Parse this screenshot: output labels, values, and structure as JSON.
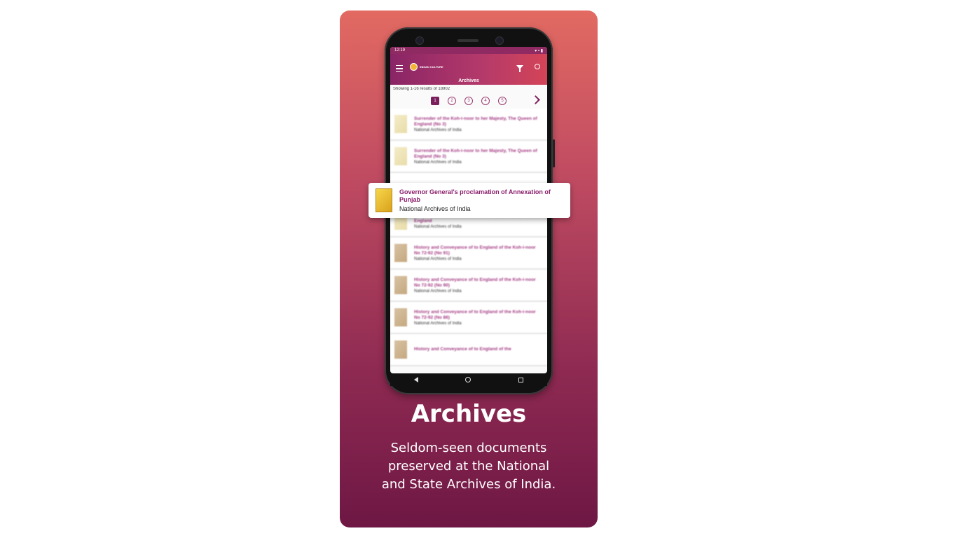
{
  "card": {
    "title": "Archives",
    "description": "Seldom-seen documents preserved at the National and State Archives of India."
  },
  "phone": {
    "status": {
      "time": "12:19",
      "icons": "▾ ▪ ▮"
    },
    "appbar": {
      "logo_text": "INDIAN CULTURE",
      "title": "Archives"
    },
    "results_text": "Showing 1-16 results of 18902",
    "pages": [
      "1",
      "2",
      "3",
      "4",
      "5"
    ],
    "list": [
      {
        "title": "Surrender of the Koh-i-noor to her Majesty, The Queen of England (No 3)",
        "source": "National Archives of India",
        "thumb": "light"
      },
      {
        "title": "Surrender of the Koh-i-noor to her Majesty, The Queen of England (No 3)",
        "source": "National Archives of India",
        "thumb": "light"
      },
      {
        "title": "",
        "source": "",
        "thumb": ""
      },
      {
        "title": "Surrender of the Koh-i-noor to her Majesty, The Queen of England",
        "source": "National Archives of India",
        "thumb": "light"
      },
      {
        "title": "History and Conveyance of to England of the Koh-i-noor No 72-92 (No 91)",
        "source": "National Archives of India",
        "thumb": "tan"
      },
      {
        "title": "History and Conveyance of to England of the Koh-i-noor No 72-92 (No 90)",
        "source": "National Archives of India",
        "thumb": "tan"
      },
      {
        "title": "History and Conveyance of to England of the Koh-i-noor No 72-92 (No 86)",
        "source": "National Archives of India",
        "thumb": "tan"
      },
      {
        "title": "History and Conveyance of to England of the",
        "source": "",
        "thumb": "tan"
      }
    ],
    "popup": {
      "title": "Governor General's proclamation of Annexation of Punjab",
      "source": "National Archives of India"
    }
  },
  "colors": {
    "card_top": "#e26a62",
    "card_bottom": "#6e1744",
    "accent": "#8a1d6a"
  }
}
